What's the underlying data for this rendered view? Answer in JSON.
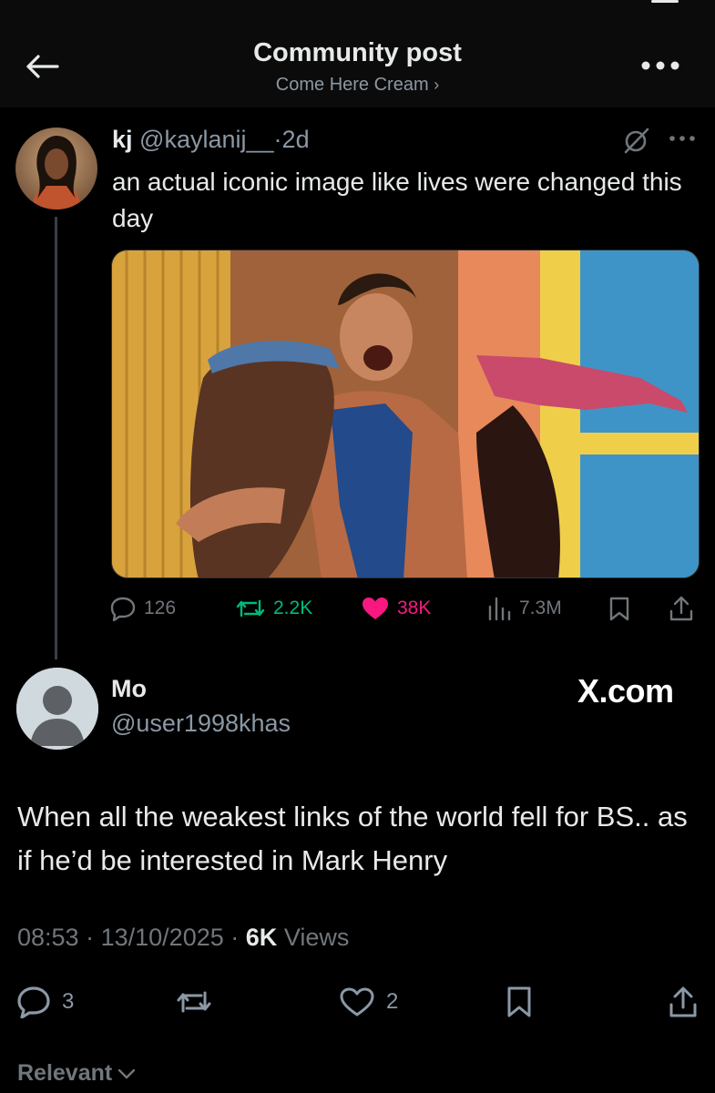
{
  "header": {
    "title": "Community post",
    "community_name": "Come Here Cream",
    "community_chevron": "›"
  },
  "quoted_tweet": {
    "name": "kj",
    "handle": "@kaylanij__",
    "separator": "·",
    "time": "2d",
    "text": "an actual iconic image like lives were changed this day",
    "media_icon": "photo",
    "actions": {
      "replies": "126",
      "reposts": "2.2K",
      "likes": "38K",
      "views": "7.3M"
    }
  },
  "main_tweet": {
    "name": "Mo",
    "handle": "@user1998khas",
    "watermark": "X.com",
    "text": "When all the weakest links of the world fell for BS.. as if he’d be interested in Mark Henry",
    "time": "08:53",
    "date": "13/10/2025",
    "separator": "·",
    "views_count": "6K",
    "views_label": "Views",
    "actions": {
      "replies": "3",
      "likes": "2"
    }
  },
  "footer": {
    "sort_label": "Relevant"
  },
  "colors": {
    "background": "#000000",
    "text_primary": "#e7e9ea",
    "text_secondary": "#71767b",
    "repost_green": "#00ba7c",
    "like_pink": "#f91880"
  }
}
